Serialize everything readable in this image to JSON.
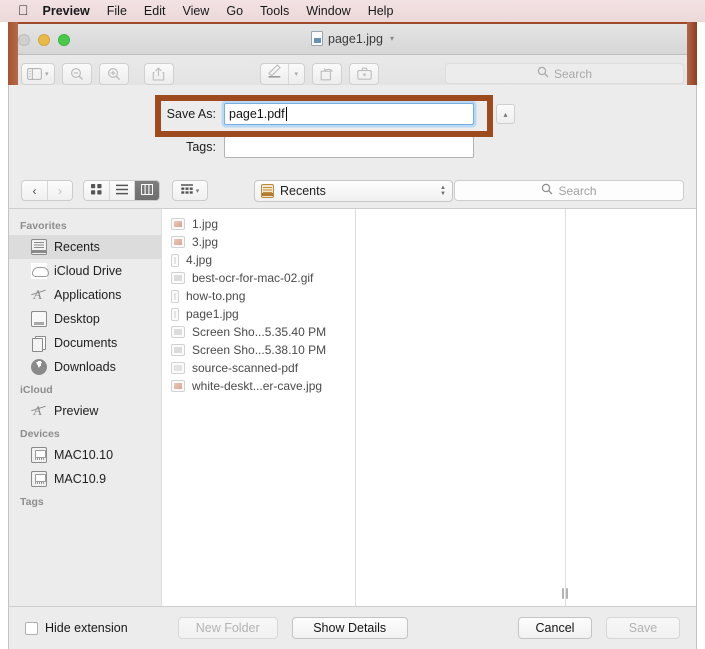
{
  "menubar": {
    "apple_icon": "apple-logo",
    "items": [
      {
        "label": "Preview",
        "bold": true
      },
      {
        "label": "File"
      },
      {
        "label": "Edit"
      },
      {
        "label": "View"
      },
      {
        "label": "Go"
      },
      {
        "label": "Tools"
      },
      {
        "label": "Window"
      },
      {
        "label": "Help"
      }
    ]
  },
  "window": {
    "title": "page1.jpg",
    "title_chevron": "chevron-down-icon",
    "traffic_lights": [
      "close",
      "minimize",
      "maximize"
    ],
    "toolbar": {
      "sidebar_icon": "sidebar-toggle-icon",
      "zoom_out_icon": "zoom-out-icon",
      "zoom_in_icon": "zoom-in-icon",
      "share_icon": "share-icon",
      "markup_icon": "markup-pen-icon",
      "rotate_icon": "rotate-icon",
      "toolkit_icon": "toolkit-icon",
      "search_placeholder": "Search",
      "search_value": ""
    }
  },
  "sheet": {
    "save_as_label": "Save As:",
    "save_as_value": "page1.pdf",
    "save_as_placeholder": "",
    "tags_label": "Tags:",
    "tags_value": "",
    "tags_placeholder": "",
    "disclosure_icon": "chevron-up-icon",
    "annotation_color": "#9C4A1E",
    "nav": {
      "back_icon": "chevron-left-icon",
      "forward_icon": "chevron-right-icon",
      "view_icon_grid": "icon-view-icon",
      "view_list": "list-view-icon",
      "view_column": "column-view-icon",
      "arrange_icon": "arrange-by-icon",
      "arrange_chevron": "chevron-down-icon",
      "location_label": "Recents",
      "location_icon": "recents-icon",
      "search_placeholder": "Search",
      "search_value": ""
    },
    "sidebar": {
      "sections": [
        {
          "header": "Favorites",
          "items": [
            {
              "label": "Recents",
              "icon": "recents-icon",
              "selected": true
            },
            {
              "label": "iCloud Drive",
              "icon": "cloud-icon",
              "selected": false
            },
            {
              "label": "Applications",
              "icon": "applications-icon",
              "selected": false
            },
            {
              "label": "Desktop",
              "icon": "desktop-icon",
              "selected": false
            },
            {
              "label": "Documents",
              "icon": "documents-icon",
              "selected": false
            },
            {
              "label": "Downloads",
              "icon": "downloads-icon",
              "selected": false
            }
          ]
        },
        {
          "header": "iCloud",
          "items": [
            {
              "label": "Preview",
              "icon": "applications-icon",
              "selected": false
            }
          ]
        },
        {
          "header": "Devices",
          "items": [
            {
              "label": "MAC10.10",
              "icon": "disk-icon",
              "selected": false
            },
            {
              "label": "MAC10.9",
              "icon": "disk-icon",
              "selected": false
            }
          ]
        },
        {
          "header": "Tags",
          "items": []
        }
      ]
    },
    "files": [
      {
        "name": "1.jpg",
        "icon": "image-thumb-icon"
      },
      {
        "name": "3.jpg",
        "icon": "image-thumb-icon"
      },
      {
        "name": "4.jpg",
        "icon": "image-thumb-icon"
      },
      {
        "name": "best-ocr-for-mac-02.gif",
        "icon": "image-thumb-icon"
      },
      {
        "name": "how-to.png",
        "icon": "image-thumb-icon"
      },
      {
        "name": "page1.jpg",
        "icon": "image-thumb-icon"
      },
      {
        "name": "Screen Sho...5.35.40 PM",
        "icon": "image-thumb-icon"
      },
      {
        "name": "Screen Sho...5.38.10 PM",
        "icon": "image-thumb-icon"
      },
      {
        "name": "source-scanned-pdf",
        "icon": "pdf-thumb-icon"
      },
      {
        "name": "white-deskt...er-cave.jpg",
        "icon": "image-thumb-icon"
      }
    ],
    "footer": {
      "hide_extension_label": "Hide extension",
      "hide_extension_checked": false,
      "new_folder_label": "New Folder",
      "new_folder_enabled": false,
      "show_details_label": "Show Details",
      "show_details_enabled": true,
      "cancel_label": "Cancel",
      "cancel_enabled": true,
      "save_label": "Save",
      "save_enabled": false
    },
    "column_handle_icon": "column-resize-handle-icon"
  }
}
